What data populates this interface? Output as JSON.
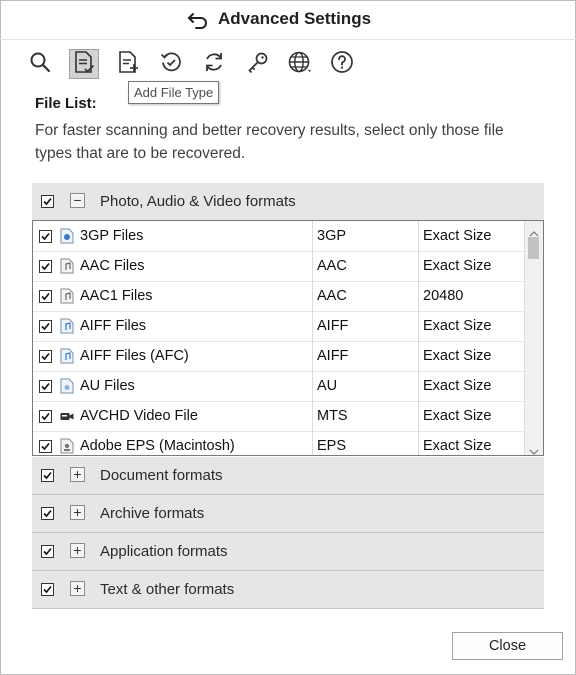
{
  "window": {
    "title": "Advanced Settings",
    "back_icon": "back-arrow-icon"
  },
  "toolbar": {
    "buttons": [
      {
        "name": "search",
        "icon": "search-icon",
        "active": false
      },
      {
        "name": "file-list",
        "icon": "file-list-icon",
        "active": true
      },
      {
        "name": "add-file-type",
        "icon": "add-file-type-icon",
        "active": false
      },
      {
        "name": "resume-recovery",
        "icon": "clock-check-icon",
        "active": false
      },
      {
        "name": "update",
        "icon": "refresh-icon",
        "active": false
      },
      {
        "name": "registration",
        "icon": "key-icon",
        "active": false
      },
      {
        "name": "language",
        "icon": "globe-icon",
        "active": false
      },
      {
        "name": "help",
        "icon": "help-icon",
        "active": false
      }
    ],
    "tooltip": "Add File Type"
  },
  "file_list": {
    "title": "File List:",
    "description": "For faster scanning and better recovery results, select only those file types that are to be recovered."
  },
  "groups": [
    {
      "label": "Photo, Audio & Video formats",
      "checked": true,
      "expanded": true,
      "expander": "−"
    },
    {
      "label": "Document formats",
      "checked": true,
      "expanded": false,
      "expander": "+"
    },
    {
      "label": "Archive formats",
      "checked": true,
      "expanded": false,
      "expander": "+"
    },
    {
      "label": "Application formats",
      "checked": true,
      "expanded": false,
      "expander": "+"
    },
    {
      "label": "Text & other formats",
      "checked": true,
      "expanded": false,
      "expander": "+"
    }
  ],
  "file_types": [
    {
      "name": "3GP Files",
      "ext": "3GP",
      "size": "Exact Size",
      "checked": true,
      "icon": "video-file-icon"
    },
    {
      "name": "AAC Files",
      "ext": "AAC",
      "size": "Exact Size",
      "checked": true,
      "icon": "audio-file-icon"
    },
    {
      "name": "AAC1 Files",
      "ext": "AAC",
      "size": "20480",
      "checked": true,
      "icon": "audio-file-icon"
    },
    {
      "name": "AIFF Files",
      "ext": "AIFF",
      "size": "Exact Size",
      "checked": true,
      "icon": "audio-file-icon"
    },
    {
      "name": "AIFF Files (AFC)",
      "ext": "AIFF",
      "size": "Exact Size",
      "checked": true,
      "icon": "audio-file-icon"
    },
    {
      "name": "AU Files",
      "ext": "AU",
      "size": "Exact Size",
      "checked": true,
      "icon": "audio-file-icon"
    },
    {
      "name": "AVCHD Video File",
      "ext": "MTS",
      "size": "Exact Size",
      "checked": true,
      "icon": "video-camera-icon"
    },
    {
      "name": "Adobe EPS (Macintosh)",
      "ext": "EPS",
      "size": "Exact Size",
      "checked": true,
      "icon": "image-file-icon"
    }
  ],
  "footer": {
    "close_label": "Close"
  },
  "colors": {
    "group_bg": "#e6e6e6",
    "active_tool_bg": "#d3d3d3"
  }
}
